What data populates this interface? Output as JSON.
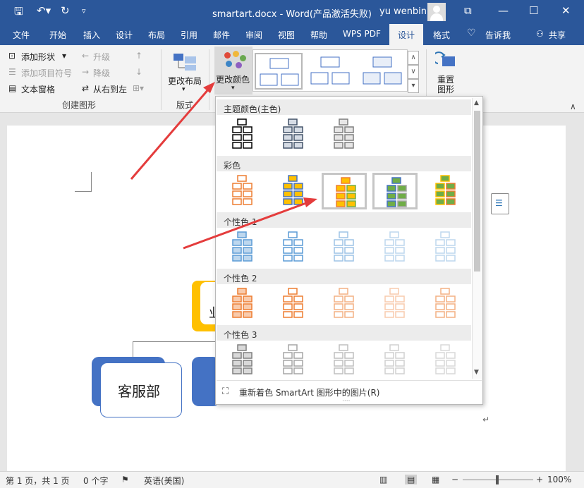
{
  "title_bar": {
    "doc_title": "smartart.docx  -  Word(产品激活失败)",
    "user": "yu wenbin",
    "bg": "#2b579a"
  },
  "tabs": [
    "文件",
    "开始",
    "插入",
    "设计",
    "布局",
    "引用",
    "邮件",
    "审阅",
    "视图",
    "帮助",
    "WPS PDF",
    "设计",
    "格式",
    "告诉我",
    "共享"
  ],
  "ribbon": {
    "create_graphic": {
      "add_shape": "添加形状",
      "add_bullet": "添加项目符号",
      "text_pane": "文本窗格",
      "promote": "升级",
      "demote": "降级",
      "rtl": "从右到左",
      "group_label": "创建图形"
    },
    "change_layout": "更改布局",
    "layouts_label": "版式",
    "change_colors": "更改颜色",
    "reset_graphic": "重置\n图形"
  },
  "dropdown": {
    "sections": [
      "主题颜色(主色)",
      "彩色",
      "个性色 1",
      "个性色 2",
      "个性色 3"
    ],
    "footer": "重新着色 SmartArt 图形中的图片(R)"
  },
  "document": {
    "box_label": "客服部",
    "box_text_partial": "业"
  },
  "status": {
    "page": "第 1 页，共 1 页",
    "words": "0 个字",
    "lang": "英语(美国)",
    "zoom": "100%"
  },
  "colors": {
    "accent": "#2b579a",
    "box": "#4472c4",
    "yellow": "#ffc000",
    "arrow": "#e43c3c"
  }
}
